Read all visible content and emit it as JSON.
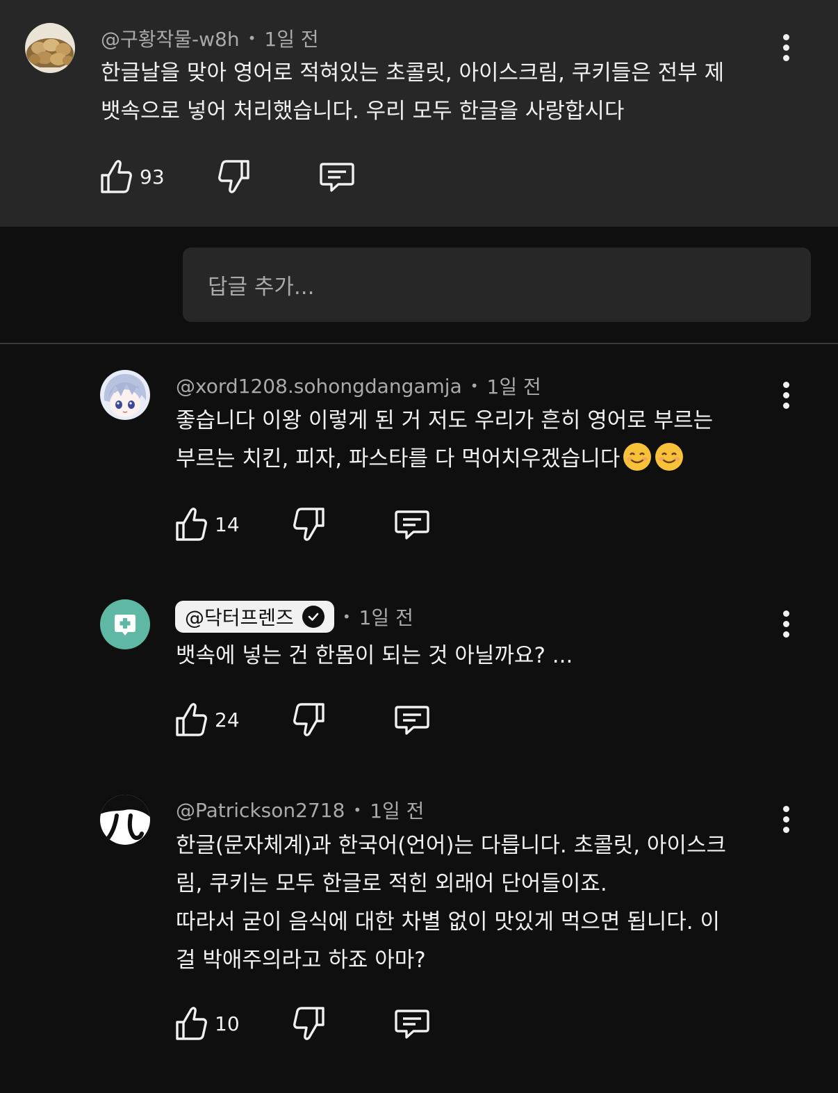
{
  "top_comment": {
    "handle": "@구황작물-w8h",
    "time": "1일 전",
    "text": "한글날을 맞아 영어로 적혀있는 초콜릿, 아이스크림, 쿠키들은 전부 제\n뱃속으로 넣어 처리했습니다. 우리 모두 한글을 사랑합시다",
    "likes": "93",
    "avatar_icon": "potatoes-avatar"
  },
  "reply_box": {
    "placeholder": "답글 추가..."
  },
  "replies": [
    {
      "handle": "@xord1208.sohongdangamja",
      "time": "1일 전",
      "text": "좋습니다 이왕 이렇게 된 거 저도 우리가 흔히 영어로 부르는\n부르는 치킨, 피자, 파스타를 다 먹어치우겠습니다",
      "emoji": "smiling-face-icon",
      "likes": "14",
      "avatar_icon": "anime-character-avatar"
    },
    {
      "handle": "@닥터프렌즈",
      "verified": true,
      "time": "1일 전",
      "text": "뱃속에 넣는 건 한몸이 되는 것 아닐까요? ...",
      "likes": "24",
      "avatar_icon": "medical-plus-avatar",
      "accent": "#5fb8a3"
    },
    {
      "handle": "@Patrickson2718",
      "time": "1일 전",
      "text": "한글(문자체계)과 한국어(언어)는 다릅니다. 초콜릿, 아이스크\n림, 쿠키는 모두 한글로 적힌 외래어 단어들이죠.\n따라서 굳이 음식에 대한 차별 없이 맛있게 먹으면 됩니다. 이\n걸 박애주의라고 하죠 아마?",
      "likes": "10",
      "avatar_icon": "pi-symbol-avatar"
    }
  ],
  "colors": {
    "background": "#0f0f0f",
    "panel": "#272727",
    "text": "#f1f1f1",
    "muted": "#aaaaaa"
  }
}
